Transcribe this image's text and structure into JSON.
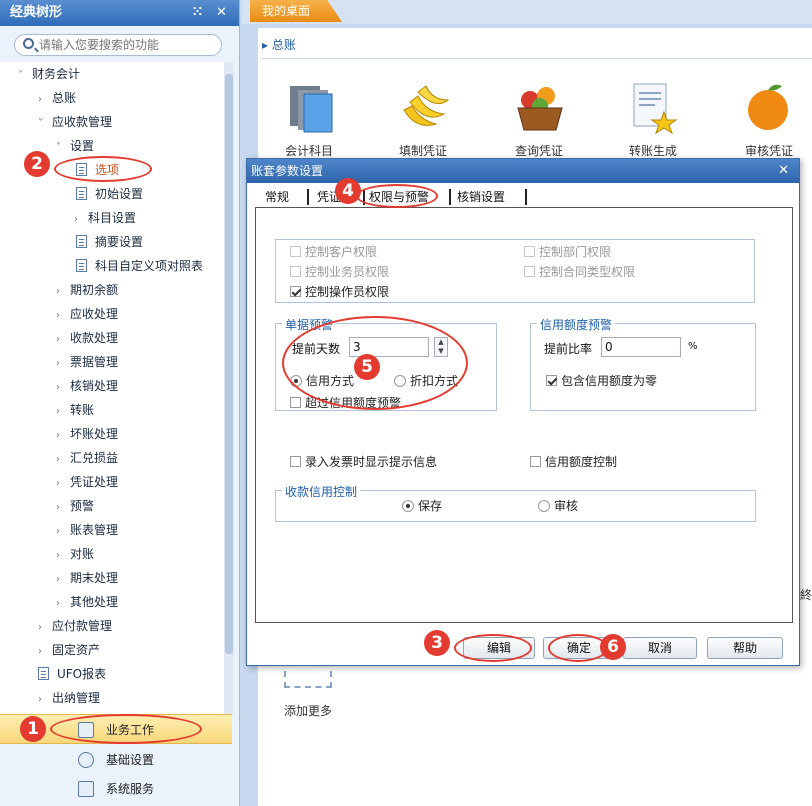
{
  "sidebar": {
    "title": "经典树形",
    "pin_glyph": "⁙",
    "close_glyph": "✕",
    "search_placeholder": "请输入您要搜索的功能",
    "tree": [
      {
        "label": "财务会计",
        "arrow": "˅"
      },
      {
        "label": "总账",
        "arrow": "›"
      },
      {
        "label": "应收款管理",
        "arrow": "˅"
      },
      {
        "label": "设置",
        "arrow": "˅"
      },
      {
        "label": "选项"
      },
      {
        "label": "初始设置"
      },
      {
        "label": "科目设置",
        "arrow": "›"
      },
      {
        "label": "摘要设置"
      },
      {
        "label": "科目自定义项对照表"
      },
      {
        "label": "期初余额",
        "arrow": "›"
      },
      {
        "label": "应收处理",
        "arrow": "›"
      },
      {
        "label": "收款处理",
        "arrow": "›"
      },
      {
        "label": "票据管理",
        "arrow": "›"
      },
      {
        "label": "核销处理",
        "arrow": "›"
      },
      {
        "label": "转账",
        "arrow": "›"
      },
      {
        "label": "坏账处理",
        "arrow": "›"
      },
      {
        "label": "汇兑损益",
        "arrow": "›"
      },
      {
        "label": "凭证处理",
        "arrow": "›"
      },
      {
        "label": "预警",
        "arrow": "›"
      },
      {
        "label": "账表管理",
        "arrow": "›"
      },
      {
        "label": "对账",
        "arrow": "›"
      },
      {
        "label": "期末处理",
        "arrow": "›"
      },
      {
        "label": "其他处理",
        "arrow": "›"
      },
      {
        "label": "应付款管理",
        "arrow": "›"
      },
      {
        "label": "固定资产",
        "arrow": "›"
      },
      {
        "label": "UFO报表"
      },
      {
        "label": "出纳管理",
        "arrow": "›"
      }
    ],
    "bottom_nav": {
      "work": "业务工作",
      "basic": "基础设置",
      "system": "系统服务"
    }
  },
  "desktop": {
    "tab": "我的桌面",
    "section_title": "▸ 总账",
    "apps": [
      "会计科目",
      "填制凭证",
      "查询凭证",
      "转账生成",
      "审核凭证"
    ],
    "add_more": "添加更多",
    "side_glyph": "終"
  },
  "dialog": {
    "title": "账套参数设置",
    "close_glyph": "✕",
    "tabs": {
      "general": "常规",
      "voucher": "凭证",
      "permission": "权限与预警",
      "writeoff": "核销设置"
    },
    "permissions": {
      "ctrl_customer": "控制客户权限",
      "ctrl_department": "控制部门权限",
      "ctrl_salesperson": "控制业务员权限",
      "ctrl_contract_type": "控制合同类型权限",
      "ctrl_operator": "控制操作员权限"
    },
    "doc_warning": {
      "title": "单据预警",
      "days_label": "提前天数",
      "days_value": "3",
      "credit_method": "信用方式",
      "discount_method": "折扣方式",
      "exceed_credit": "超过信用额度预警"
    },
    "credit_warning": {
      "title": "信用额度预警",
      "ratio_label": "提前比率",
      "ratio_value": "0",
      "ratio_unit": "%",
      "include_zero": "包含信用额度为零"
    },
    "invoice_prompt": "录入发票时显示提示信息",
    "credit_control": "信用额度控制",
    "receipt_credit": {
      "title": "收款信用控制",
      "save": "保存",
      "audit": "审核"
    },
    "buttons": {
      "edit": "编辑",
      "ok": "确定",
      "cancel": "取消",
      "help": "帮助"
    },
    "spin_up": "▲",
    "spin_down": "▼"
  },
  "annotations": [
    "1",
    "2",
    "3",
    "4",
    "5",
    "6"
  ],
  "colors": {
    "title_bar": "#2f6cb8",
    "tab_orange": "#ea8b12",
    "annotation_red": "#e33b2f",
    "selected_item": "#f7d77a"
  }
}
